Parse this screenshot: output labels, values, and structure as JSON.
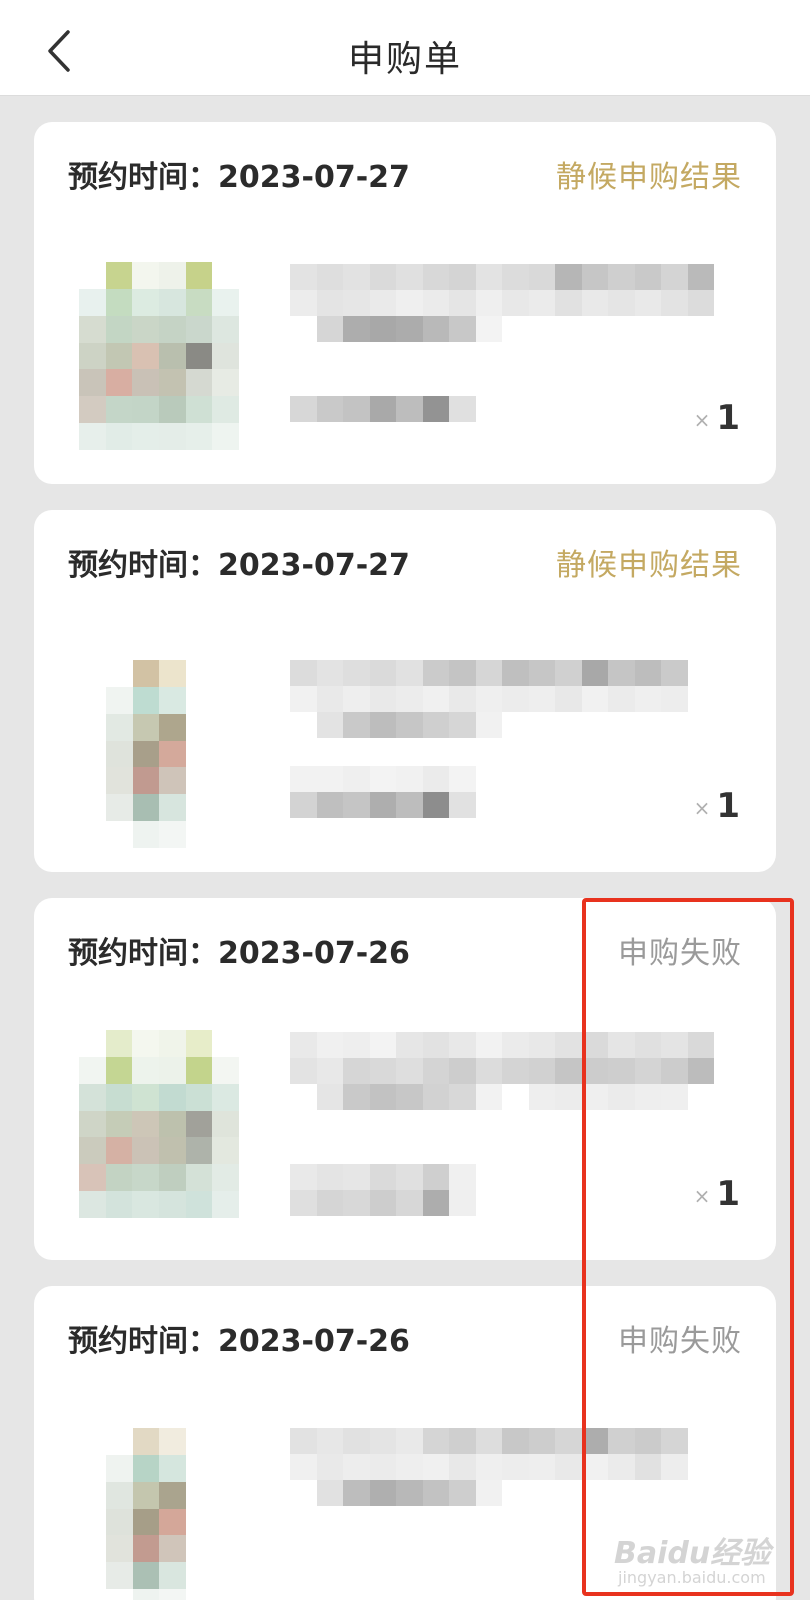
{
  "header": {
    "title": "申购单",
    "back_icon": "chevron-left-icon"
  },
  "orders": [
    {
      "date_label": "预约时间：2023-07-27",
      "status": "静候申购结果",
      "status_color": "#c4a962",
      "quantity_prefix": "×",
      "quantity": "1"
    },
    {
      "date_label": "预约时间：2023-07-27",
      "status": "静候申购结果",
      "status_color": "#c4a962",
      "quantity_prefix": "×",
      "quantity": "1"
    },
    {
      "date_label": "预约时间：2023-07-26",
      "status": "申购失败",
      "status_color": "#9a9a9a",
      "quantity_prefix": "×",
      "quantity": "1"
    },
    {
      "date_label": "预约时间：2023-07-26",
      "status": "申购失败",
      "status_color": "#9a9a9a"
    }
  ],
  "annotation": {
    "highlight_color": "#e8321e"
  },
  "watermark": {
    "main": "Baidu经验",
    "sub": "jingyan.baidu.com"
  }
}
